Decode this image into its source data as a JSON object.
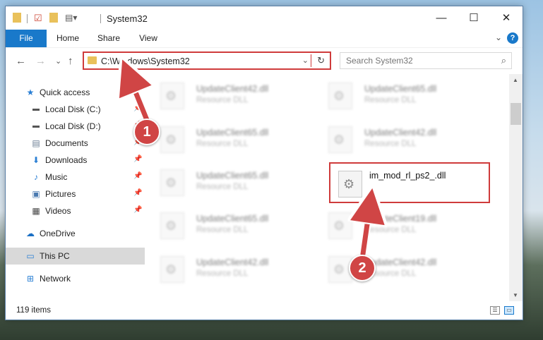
{
  "window": {
    "title": "System32",
    "minimize_glyph": "—",
    "maximize_glyph": "☐",
    "close_glyph": "✕"
  },
  "ribbon": {
    "tabs": [
      "File",
      "Home",
      "Share",
      "View"
    ],
    "expand_glyph": "⌄",
    "help_glyph": "?"
  },
  "navigation": {
    "back_glyph": "←",
    "forward_glyph": "→",
    "recent_glyph": "⌄",
    "up_glyph": "↑",
    "address": "C:\\Windows\\System32",
    "search_placeholder": "Search System32"
  },
  "nav_pane": {
    "items": [
      {
        "label": "Quick access",
        "icon": "star-icon"
      },
      {
        "label": "Local Disk (C:)",
        "icon": "drive-icon"
      },
      {
        "label": "Local Disk (D:)",
        "icon": "drive-icon"
      },
      {
        "label": "Documents",
        "icon": "documents-icon"
      },
      {
        "label": "Downloads",
        "icon": "downloads-icon"
      },
      {
        "label": "Music",
        "icon": "music-icon"
      },
      {
        "label": "Pictures",
        "icon": "pictures-icon"
      },
      {
        "label": "Videos",
        "icon": "videos-icon"
      },
      {
        "label": "OneDrive",
        "icon": "cloud-icon"
      },
      {
        "label": "This PC",
        "icon": "computer-icon"
      },
      {
        "label": "Network",
        "icon": "network-icon"
      }
    ]
  },
  "files": [
    {
      "name": "UpdateClient42.dll",
      "type": "Resource DLL"
    },
    {
      "name": "UpdateClient65.dll",
      "type": "Resource DLL"
    },
    {
      "name": "UpdateClient65.dll",
      "type": "Resource DLL"
    },
    {
      "name": "UpdateClient42.dll",
      "type": "Resource DLL"
    },
    {
      "name": "UpdateClient65.dll",
      "type": "Resource DLL"
    },
    {
      "name": "im_mod_rl_ps2_.dll",
      "type": ""
    },
    {
      "name": "UpdateClient65.dll",
      "type": "Resource DLL"
    },
    {
      "name": "UpdateClient19.dll",
      "type": "Resource DLL"
    },
    {
      "name": "UpdateClient42.dll",
      "type": "Resource DLL"
    },
    {
      "name": "UpdateClient42.dll",
      "type": "Resource DLL"
    }
  ],
  "status": {
    "item_count": "119 items"
  },
  "annotations": {
    "step1": "1",
    "step2": "2",
    "color": "#d04545"
  },
  "colors": {
    "accent": "#1979ca",
    "highlight": "#cf3b3b"
  }
}
